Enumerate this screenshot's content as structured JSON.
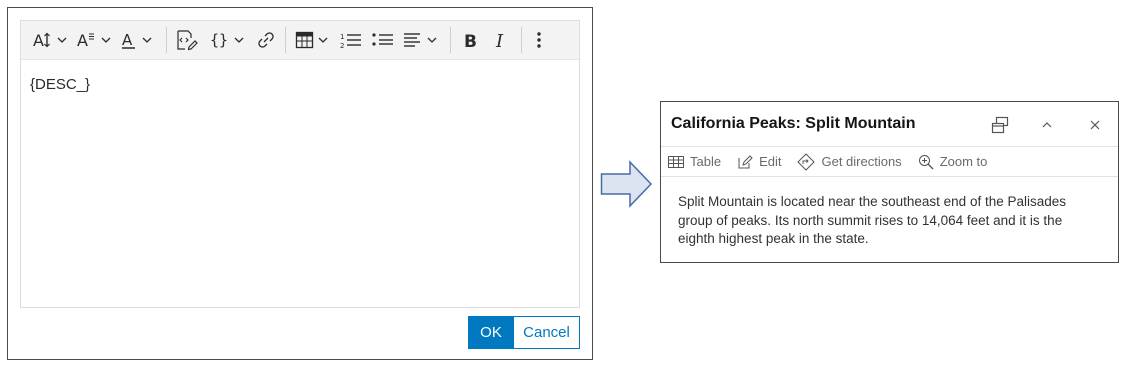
{
  "editor": {
    "toolbar": {
      "icons": [
        "font-size-icon",
        "font-style-icon",
        "font-color-icon",
        "insert-expression-icon",
        "insert-field-icon",
        "link-icon",
        "table-icon",
        "numbered-list-icon",
        "bulleted-list-icon",
        "align-icon",
        "bold-icon",
        "italic-icon",
        "more-icon"
      ]
    },
    "content": "{DESC_}",
    "ok_label": "OK",
    "cancel_label": "Cancel"
  },
  "popup": {
    "title": "California Peaks: Split Mountain",
    "actions": [
      {
        "label": "Table",
        "icon": "table-icon"
      },
      {
        "label": "Edit",
        "icon": "edit-icon"
      },
      {
        "label": "Get directions",
        "icon": "directions-icon"
      },
      {
        "label": "Zoom to",
        "icon": "zoom-to-icon"
      }
    ],
    "body": "Split Mountain is located near the southeast end of the Palisades group of peaks. Its north summit rises to 14,064 feet and it is the eighth highest peak in the state."
  },
  "colors": {
    "accent": "#0079c1",
    "arrow_fill": "#dbe5f1",
    "arrow_stroke": "#4a6aa5"
  }
}
